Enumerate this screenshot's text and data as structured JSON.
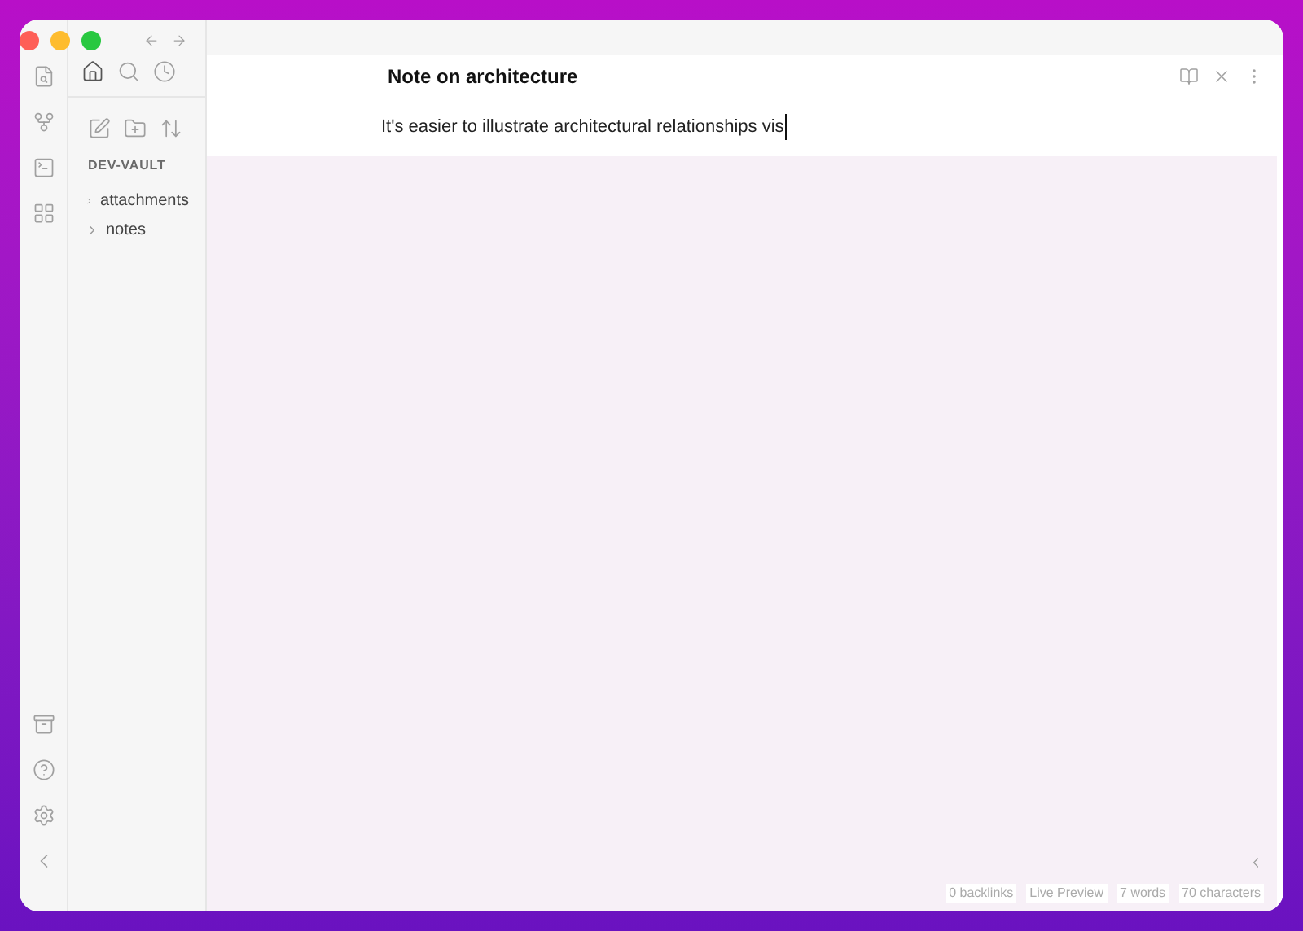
{
  "sidebar": {
    "vault_name": "DEV-VAULT",
    "items": [
      {
        "label": "attachments",
        "expanded": false
      },
      {
        "label": "notes",
        "expanded": false
      }
    ]
  },
  "note": {
    "title": "Note on architecture",
    "text": "It's easier to illustrate architectural relationships vis"
  },
  "status_bar": [
    "0 backlinks",
    "Live Preview",
    "7 words",
    "70 characters"
  ]
}
